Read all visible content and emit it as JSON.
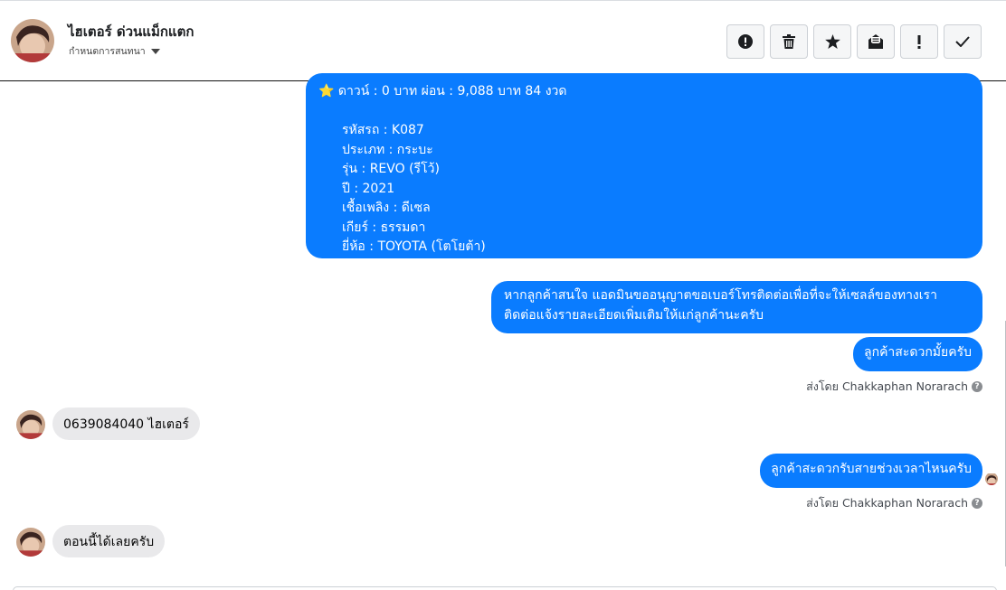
{
  "header": {
    "contact_name": "ไฮเตอร์ ด่วนแม็กแตก",
    "assign_label": "กำหนดการสนทนา",
    "toolbar": [
      {
        "name": "report-button",
        "icon": "alert-circle-icon"
      },
      {
        "name": "delete-button",
        "icon": "trash-icon"
      },
      {
        "name": "star-button",
        "icon": "star-icon"
      },
      {
        "name": "mark-unread-button",
        "icon": "envelope-open-icon"
      },
      {
        "name": "spam-button",
        "icon": "exclamation-icon"
      },
      {
        "name": "done-button",
        "icon": "checkmark-icon"
      }
    ]
  },
  "messages": {
    "big": {
      "star_line": "ดาวน์ : 0 บาท ผ่อน : 9,088 บาท 84 งวด",
      "lines": [
        "",
        "รหัสรถ : K087",
        "ประเภท : กระบะ",
        "รุ่น : REVO (รีโว้)",
        "ปี : 2021",
        "เชื้อเพลิง : ดีเซล",
        "เกียร์ : ธรรมดา",
        "ยี่ห้อ : TOYOTA (โตโยต้า)"
      ]
    },
    "m2_line1": "หากลูกค้าสนใจ แอดมินขออนุญาตขอเบอร์โทรติดต่อเพื่อที่จะให้เซลล์ของทางเรา",
    "m2_line2": "ติดต่อแจ้งรายละเอียดเพิ่มเติมให้แก่ลูกค้านะครับ",
    "m3": "ลูกค้าสะดวกมั้ยครับ",
    "sent_by_1": "ส่งโดย Chakkaphan Norarach",
    "in1": "0639084040 ไฮเตอร์",
    "m4": "ลูกค้าสะดวกรับสายช่วงเวลาไหนครับ",
    "sent_by_2": "ส่งโดย Chakkaphan Norarach",
    "in2": "ตอนนี้ได้เลยครับ"
  },
  "colors": {
    "outgoing": "#0a7cff",
    "incoming": "#e9e9eb"
  }
}
